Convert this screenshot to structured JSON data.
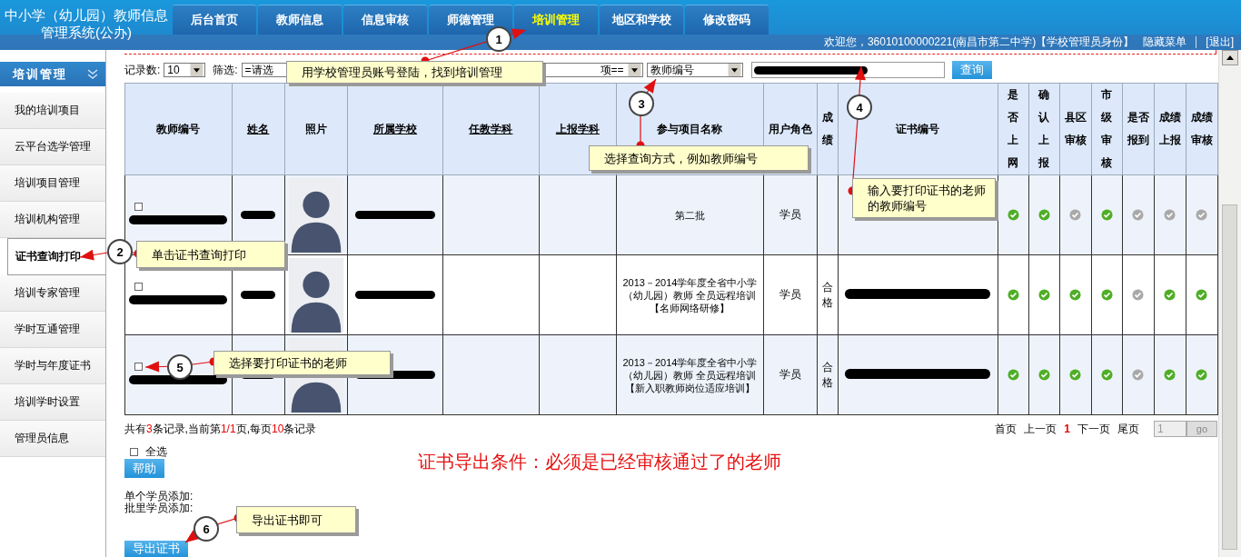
{
  "app_title": [
    "中小学（幼儿园）教师信息",
    "管理系统(公办)"
  ],
  "tabs": [
    {
      "label": "后台首页",
      "selected": false
    },
    {
      "label": "教师信息",
      "selected": false
    },
    {
      "label": "信息审核",
      "selected": false
    },
    {
      "label": "师德管理",
      "selected": false
    },
    {
      "label": "培训管理",
      "selected": true
    },
    {
      "label": "地区和学校",
      "selected": false
    },
    {
      "label": "修改密码",
      "selected": false
    }
  ],
  "user_bar": {
    "welcome": "欢迎您，36010100000221(南昌市第二中学)【学校管理员身份】",
    "links": [
      "隐藏菜单",
      "[退出]"
    ]
  },
  "sidebar": {
    "title": "培训管理",
    "items": [
      {
        "label": "我的培训项目",
        "selected": false
      },
      {
        "label": "云平台选学管理",
        "selected": false
      },
      {
        "label": "培训项目管理",
        "selected": false
      },
      {
        "label": "培训机构管理",
        "selected": false
      },
      {
        "label": "证书查询打印",
        "selected": true
      },
      {
        "label": "培训专家管理",
        "selected": false
      },
      {
        "label": "学时互通管理",
        "selected": false
      },
      {
        "label": "学时与年度证书",
        "selected": false
      },
      {
        "label": "培训学时设置",
        "selected": false
      },
      {
        "label": "管理员信息",
        "selected": false
      }
    ]
  },
  "filters": {
    "records_label": "记录数:",
    "page_size": "10",
    "filter_label": "筛选:",
    "select_1": "=请选",
    "select_2": "项==",
    "field_select": "教师编号",
    "search_button": "查询"
  },
  "table": {
    "columns": [
      {
        "label": "教师编号",
        "kind": "plain"
      },
      {
        "label": "姓名",
        "kind": "link"
      },
      {
        "label": "照片",
        "kind": "plain"
      },
      {
        "label": "所属学校",
        "kind": "link"
      },
      {
        "label": "任教学科",
        "kind": "link"
      },
      {
        "label": "上报学科",
        "kind": "link"
      },
      {
        "label": "参与项目名称",
        "kind": "plain"
      },
      {
        "label": "用户角色",
        "kind": "plain"
      },
      {
        "label": "成绩",
        "kind": "vertical"
      },
      {
        "label": "证书编号",
        "kind": "plain"
      },
      {
        "label": "是否上网",
        "kind": "vertical"
      },
      {
        "label": "确认上报",
        "kind": "vertical"
      },
      {
        "label": "县区审核",
        "kind": "vertical"
      },
      {
        "label": "市级审核",
        "kind": "vertical"
      },
      {
        "label": "是否报到",
        "kind": "vertical"
      },
      {
        "label": "成绩上报",
        "kind": "vertical"
      },
      {
        "label": "成绩审核",
        "kind": "vertical"
      }
    ],
    "rows": [
      {
        "checked": false,
        "project": "第二批",
        "role": "学员",
        "certificate_redacted": false,
        "statuses": [
          true,
          true,
          false,
          true,
          false,
          false,
          false
        ]
      },
      {
        "checked": false,
        "project": "2013－2014学年度全省中小学（幼儿园）教师 全员远程培训【名师网络研修】",
        "role": "学员",
        "score": "合格",
        "certificate_redacted": true,
        "statuses": [
          true,
          true,
          true,
          true,
          false,
          true,
          true
        ]
      },
      {
        "checked": false,
        "project": "2013－2014学年度全省中小学（幼儿园）教师 全员远程培训【新入职教师岗位适应培训】",
        "role": "学员",
        "score": "合格",
        "certificate_redacted": true,
        "statuses": [
          true,
          true,
          true,
          true,
          false,
          true,
          true
        ]
      }
    ]
  },
  "pagination": {
    "summary": [
      {
        "text": "共有",
        "highlight": false
      },
      {
        "text": "3",
        "highlight": true
      },
      {
        "text": "条记录,当前第",
        "highlight": false
      },
      {
        "text": "1/1",
        "highlight": true
      },
      {
        "text": "页,每页",
        "highlight": false
      },
      {
        "text": "10",
        "highlight": true
      },
      {
        "text": "条记录",
        "highlight": false
      }
    ],
    "links": [
      {
        "label": "首页",
        "current": false
      },
      {
        "label": "上一页",
        "current": false
      },
      {
        "label": "1",
        "current": true
      },
      {
        "label": "下一页",
        "current": false
      },
      {
        "label": "尾页",
        "current": false
      }
    ],
    "page_input": "1",
    "go_button": "go",
    "disabled": true
  },
  "select_all": {
    "label": "全选",
    "checked": false
  },
  "help_button": "帮助",
  "notice": "证书导出条件：必须是已经审核通过了的老师",
  "add_labels": [
    "单个学员添加:",
    "批里学员添加:"
  ],
  "export_button": "导出证书",
  "annotations": [
    {
      "number": "1",
      "text": "用学校管理员账号登陆，找到培训管理"
    },
    {
      "number": "2",
      "text": "单击证书查询打印"
    },
    {
      "number": "3",
      "text": "选择查询方式，例如教师编号"
    },
    {
      "number": "4",
      "text": "输入要打印证书的老师的教师编号"
    },
    {
      "number": "5",
      "text": "选择要打印证书的老师"
    },
    {
      "number": "6",
      "text": "导出证书即可"
    }
  ]
}
